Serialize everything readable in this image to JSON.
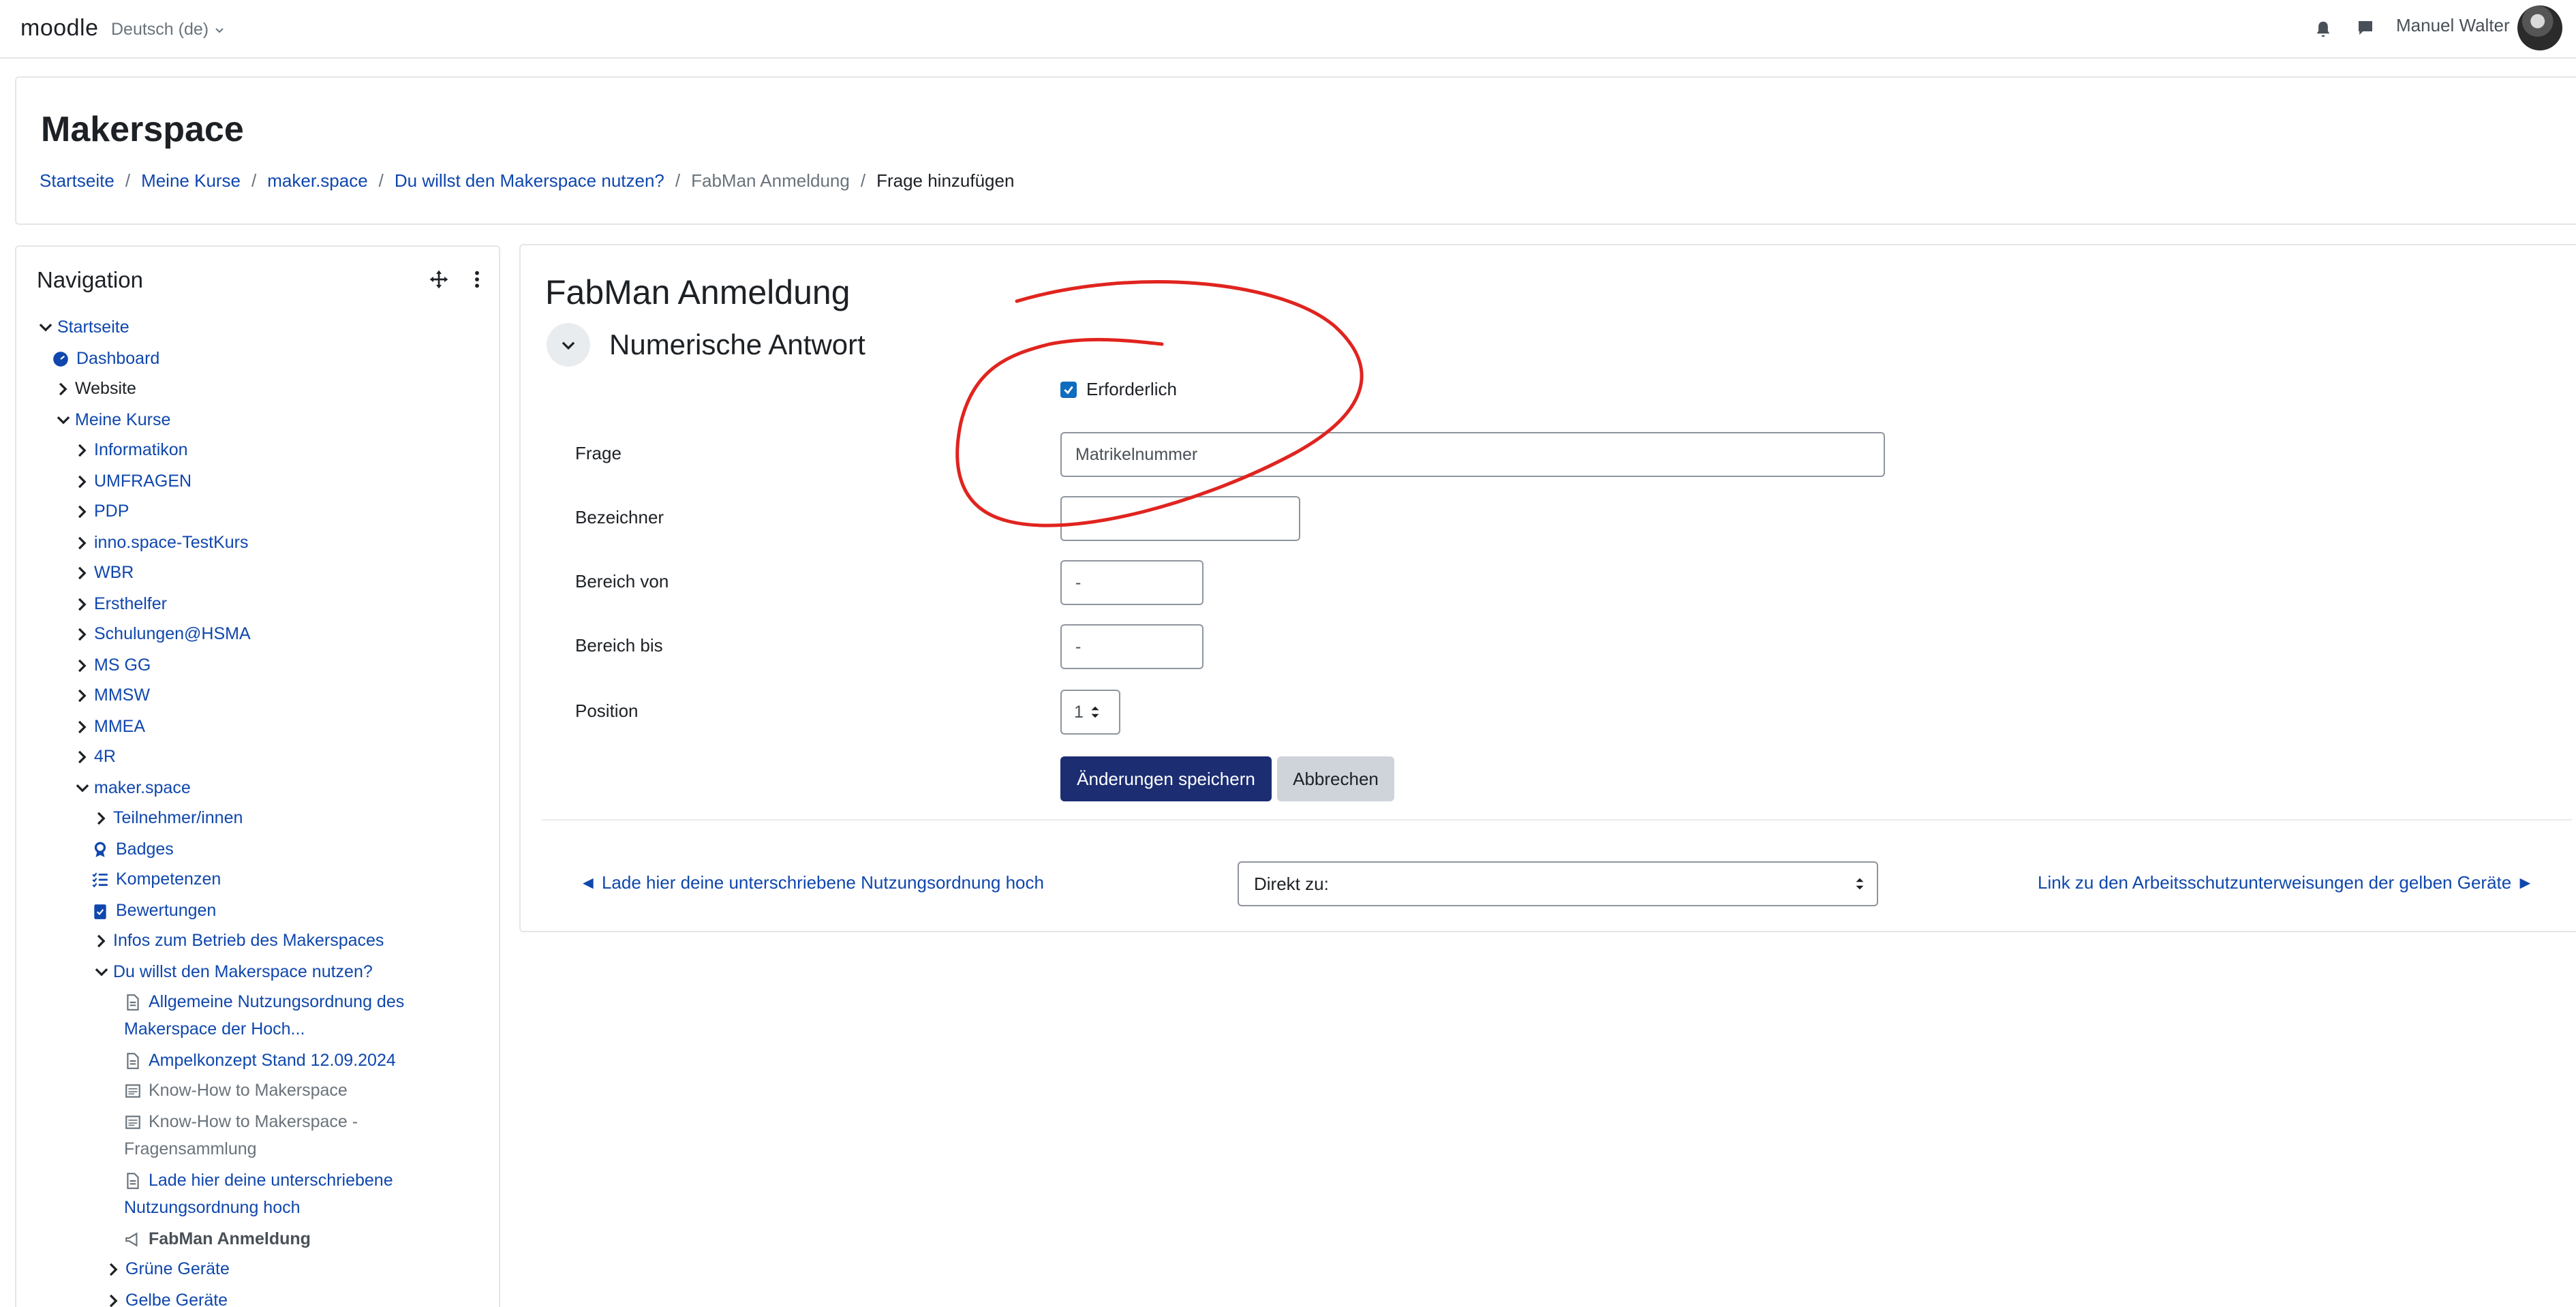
{
  "navbar": {
    "brand": "moodle",
    "language": "Deutsch (de)",
    "user_name": "Manuel Walter"
  },
  "header": {
    "title": "Makerspace",
    "breadcrumb": [
      "Startseite",
      "Meine Kurse",
      "maker.space",
      "Du willst den Makerspace nutzen?",
      "FabMan Anmeldung",
      "Frage hinzufügen"
    ]
  },
  "navigation": {
    "title": "Navigation",
    "items": [
      {
        "label": "Startseite"
      },
      {
        "label": "Dashboard"
      },
      {
        "label": "Website"
      },
      {
        "label": "Meine Kurse"
      },
      {
        "label": "Informatikon"
      },
      {
        "label": "UMFRAGEN"
      },
      {
        "label": "PDP"
      },
      {
        "label": "inno.space-TestKurs"
      },
      {
        "label": "WBR"
      },
      {
        "label": "Ersthelfer"
      },
      {
        "label": "Schulungen@HSMA"
      },
      {
        "label": "MS GG"
      },
      {
        "label": "MMSW"
      },
      {
        "label": "MMEA"
      },
      {
        "label": "4R"
      },
      {
        "label": "maker.space"
      },
      {
        "label": "Teilnehmer/innen"
      },
      {
        "label": "Badges"
      },
      {
        "label": "Kompetenzen"
      },
      {
        "label": "Bewertungen"
      },
      {
        "label": "Infos zum Betrieb des Makerspaces"
      },
      {
        "label": "Du willst den Makerspace nutzen?"
      },
      {
        "label": "Allgemeine Nutzungsordnung des"
      },
      {
        "label": "Makerspace der Hoch..."
      },
      {
        "label": "Ampelkonzept Stand 12.09.2024"
      },
      {
        "label": "Know-How to Makerspace"
      },
      {
        "label": "Know-How to Makerspace -"
      },
      {
        "label": "Fragensammlung"
      },
      {
        "label": "Lade hier deine unterschriebene"
      },
      {
        "label": "Nutzungsordnung hoch"
      },
      {
        "label": "FabMan Anmeldung"
      },
      {
        "label": "Grüne Geräte"
      },
      {
        "label": "Gelbe Geräte"
      }
    ]
  },
  "main": {
    "activity_title": "FabMan Anmeldung",
    "section_title": "Numerische Antwort",
    "required_label": "Erforderlich",
    "fields": {
      "frage_label": "Frage",
      "frage_value": "Matrikelnummer",
      "bezeichner_label": "Bezeichner",
      "bezeichner_value": "",
      "von_label": "Bereich von",
      "von_value": "-",
      "bis_label": "Bereich bis",
      "bis_value": "-",
      "position_label": "Position",
      "position_value": "1"
    },
    "save_label": "Änderungen speichern",
    "cancel_label": "Abbrechen",
    "prev_link": "◄ Lade hier deine unterschriebene Nutzungsordnung hoch",
    "jump_label": "Direkt zu:",
    "next_link": "Link zu den Arbeitsschutzunterweisungen der gelben Geräte ►"
  }
}
